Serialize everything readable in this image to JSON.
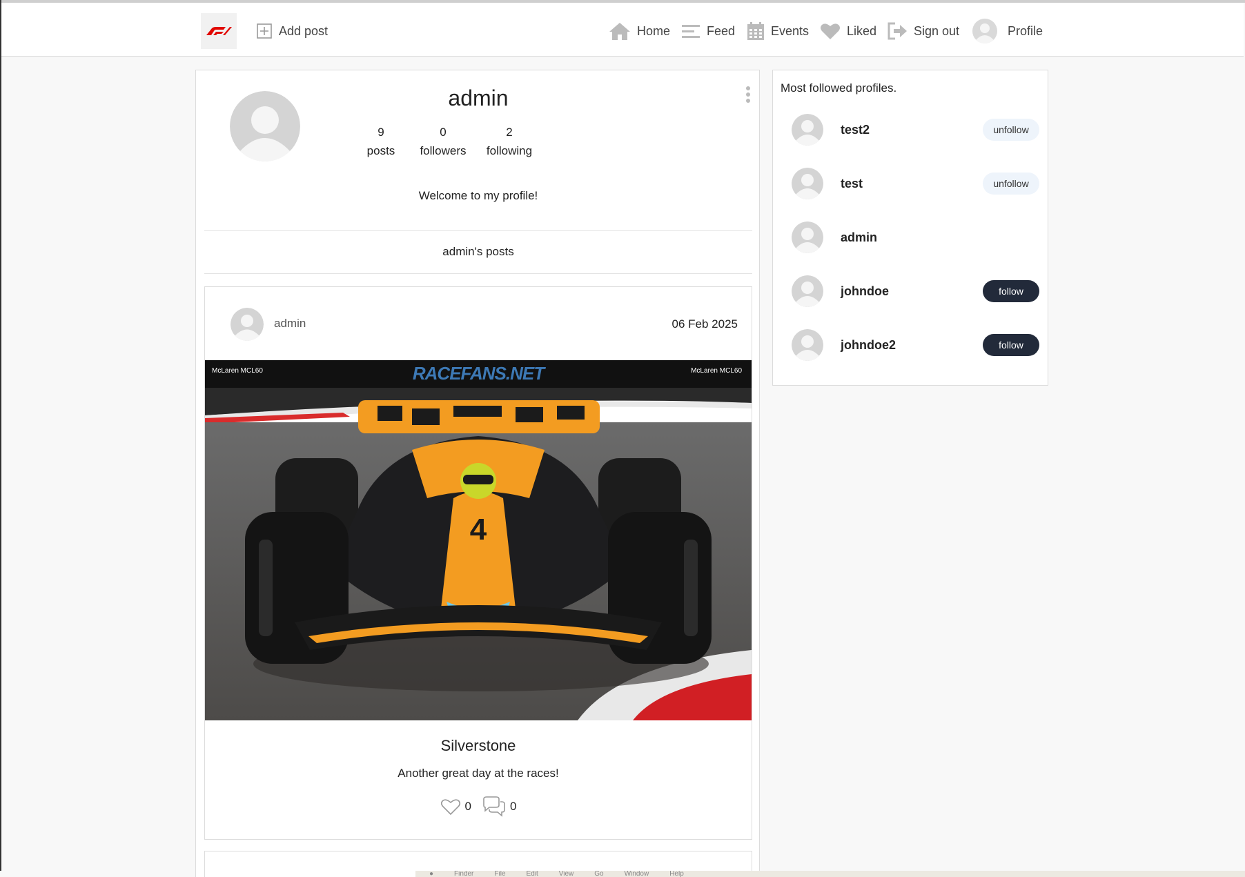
{
  "nav": {
    "add_post": "Add post",
    "home": "Home",
    "feed": "Feed",
    "events": "Events",
    "liked": "Liked",
    "sign_out": "Sign out",
    "profile": "Profile"
  },
  "profile": {
    "username": "admin",
    "posts_count": "9",
    "posts_label": "posts",
    "followers_count": "0",
    "followers_label": "followers",
    "following_count": "2",
    "following_label": "following",
    "bio": "Welcome to my profile!",
    "posts_heading": "admin's posts"
  },
  "post": {
    "author": "admin",
    "date": "06 Feb 2025",
    "image_caption_left": "McLaren MCL60",
    "image_caption_right": "McLaren MCL60",
    "image_watermark": "RACEFANS.NET",
    "title": "Silverstone",
    "body": "Another great day at the races!",
    "likes": "0",
    "comments": "0"
  },
  "sidebar": {
    "title": "Most followed profiles.",
    "profiles": [
      {
        "name": "test2",
        "action": "unfollow"
      },
      {
        "name": "test",
        "action": "unfollow"
      },
      {
        "name": "admin",
        "action": ""
      },
      {
        "name": "johndoe",
        "action": "follow"
      },
      {
        "name": "johndoe2",
        "action": "follow"
      }
    ]
  },
  "os_menu": [
    "Finder",
    "File",
    "Edit",
    "View",
    "Go",
    "Window",
    "Help"
  ],
  "colors": {
    "follow_button": "#222a3a",
    "unfollow_button": "#eef4fb",
    "brand_red": "#e10600"
  }
}
